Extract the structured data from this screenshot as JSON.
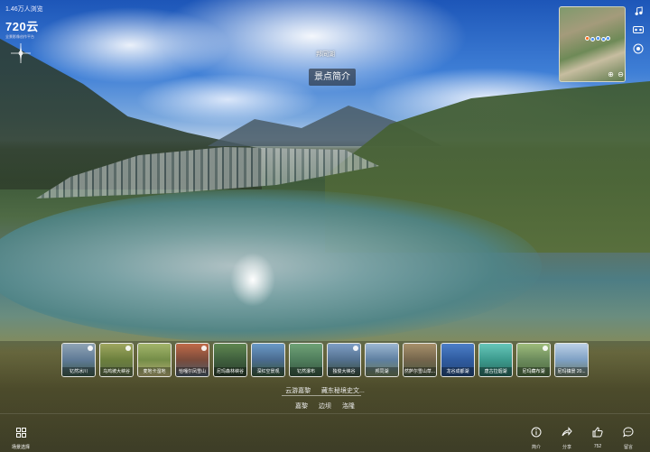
{
  "app": {
    "view_count": "1.46万人浏览",
    "logo": "720云",
    "tagline": "全景影像创作平台"
  },
  "pano": {
    "title": "邦同湖",
    "intro_button": "景点简介"
  },
  "minimap": {
    "zoom_in": "⊕",
    "zoom_out": "⊖"
  },
  "side_icons": [
    "music-icon",
    "vr-glasses-icon",
    "gyroscope-icon"
  ],
  "thumbnails": [
    {
      "label": "钇然冰川",
      "colors": [
        "#5f7a96",
        "#8fa3b4",
        "#3d5a4b"
      ],
      "vr": true
    },
    {
      "label": "乌鸡坡大峡谷",
      "colors": [
        "#6b7f3d",
        "#9ea65f",
        "#5b6b48"
      ],
      "vr": true
    },
    {
      "label": "麦地卡湿地",
      "colors": [
        "#748d48",
        "#a2b46a",
        "#b8b078"
      ],
      "vr": false
    },
    {
      "label": "恰嘎尔凤雪山",
      "colors": [
        "#7a4b3b",
        "#c06a48",
        "#4f5f6d"
      ],
      "vr": true
    },
    {
      "label": "尼玛森林峡谷",
      "colors": [
        "#3f5f3d",
        "#5f8650",
        "#2d3f2e"
      ],
      "vr": false
    },
    {
      "label": "深红空景观",
      "colors": [
        "#4a6b8f",
        "#6a9ac7",
        "#3a5a3c"
      ],
      "vr": false
    },
    {
      "label": "钇然瀑布",
      "colors": [
        "#4f7d5c",
        "#6fa276",
        "#36553f"
      ],
      "vr": false
    },
    {
      "label": "独俊大峡谷",
      "colors": [
        "#53708e",
        "#7e9ec4",
        "#3a4f3c"
      ],
      "vr": true
    },
    {
      "label": "邦同湖",
      "colors": [
        "#5e7fa0",
        "#9cb7d2",
        "#6e7e5a"
      ],
      "vr": false
    },
    {
      "label": "然萨尔雪山草...",
      "colors": [
        "#74654c",
        "#a7906a",
        "#4b5b43"
      ],
      "vr": false
    },
    {
      "label": "龙谷成都湖",
      "colors": [
        "#2f5b9f",
        "#4c7ec8",
        "#25497b"
      ],
      "vr": false
    },
    {
      "label": "唐古拉烟湖",
      "colors": [
        "#3c9a8d",
        "#66c6b9",
        "#2a6a5f"
      ],
      "vr": false
    },
    {
      "label": "尼玛藏布湖",
      "colors": [
        "#6b8a5c",
        "#9dbb7a",
        "#4c6a3e"
      ],
      "vr": true
    },
    {
      "label": "尼玛镇景 20...",
      "colors": [
        "#7ea0c4",
        "#bcd0e6",
        "#6a7a64"
      ],
      "vr": false
    }
  ],
  "groups": [
    "云游嘉黎",
    "藏东秘境史文..."
  ],
  "subgroups": [
    "嘉黎",
    "边坝",
    "洛隆"
  ],
  "scene_select": {
    "label": "场景选择",
    "icon": "grid-icon"
  },
  "actions": [
    {
      "name": "intro-action",
      "label": "简介",
      "icon": "info-icon"
    },
    {
      "name": "share-action",
      "label": "分享",
      "icon": "share-icon"
    },
    {
      "name": "like-action",
      "label": "752",
      "icon": "thumbs-up-icon"
    },
    {
      "name": "comment-action",
      "label": "留言",
      "icon": "comment-icon"
    }
  ]
}
